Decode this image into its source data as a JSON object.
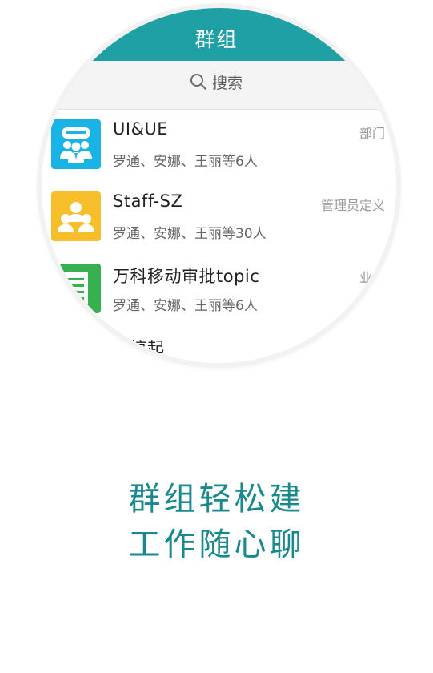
{
  "header": {
    "title": "群组"
  },
  "search": {
    "label": "搜索"
  },
  "groups": [
    {
      "name": "UI&UE",
      "members": "罗通、安娜、王丽等6人",
      "tag": "部门",
      "icon": "people-meeting-icon",
      "color": "#1ab3e6"
    },
    {
      "name": "Staff-SZ",
      "members": "罗通、安娜、王丽等30人",
      "tag": "管理员定义",
      "icon": "group-users-icon",
      "color": "#f6be2b"
    },
    {
      "name": "万科移动审批topic",
      "members": "罗通、安娜、王丽等6人",
      "tag": "业务",
      "icon": "document-list-icon",
      "color": "#37b04f"
    },
    {
      "name": "球搞起",
      "members": "",
      "tag": "",
      "icon": "",
      "color": ""
    }
  ],
  "slogan": {
    "line1": "群组轻松建",
    "line2": "工作随心聊"
  },
  "colors": {
    "accent": "#1fa0a4",
    "slogan": "#19898e"
  }
}
